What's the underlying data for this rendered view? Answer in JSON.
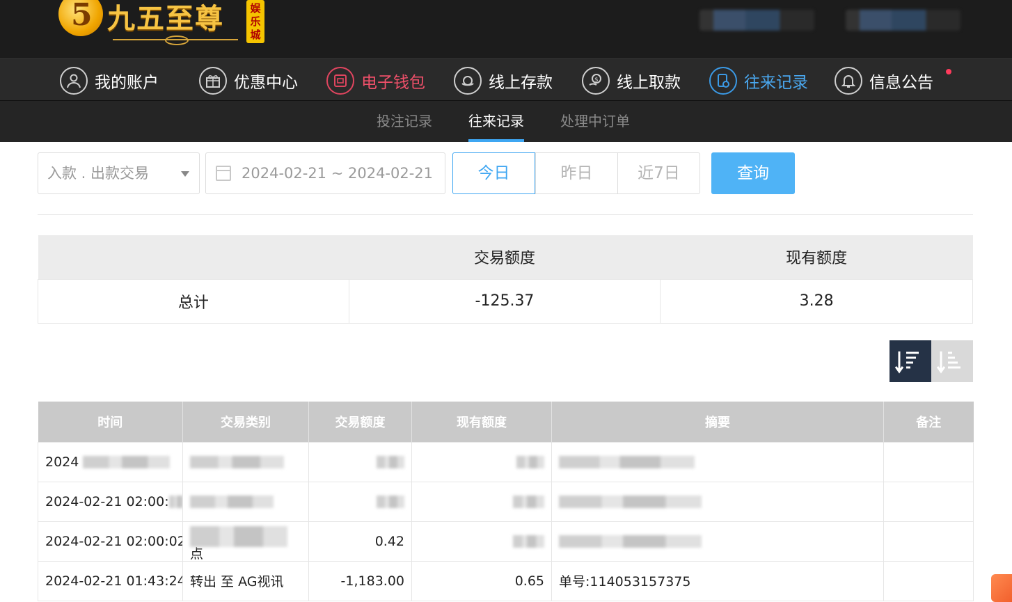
{
  "header": {
    "logo_text": "九五至尊",
    "logo_tag": "娱乐城"
  },
  "mainnav": {
    "items": [
      {
        "label": "我的账户",
        "icon": "user-icon"
      },
      {
        "label": "优惠中心",
        "icon": "gift-icon"
      },
      {
        "label": "电子钱包",
        "icon": "wallet-icon"
      },
      {
        "label": "线上存款",
        "icon": "deposit-icon"
      },
      {
        "label": "线上取款",
        "icon": "withdraw-icon"
      },
      {
        "label": "往来记录",
        "icon": "records-icon"
      },
      {
        "label": "信息公告",
        "icon": "bell-icon"
      }
    ]
  },
  "subnav": {
    "tabs": [
      "投注记录",
      "往来记录",
      "处理中订单"
    ],
    "active": "往来记录"
  },
  "filters": {
    "type_select": "入款 . 出款交易",
    "date_range": "2024-02-21 ~ 2024-02-21",
    "quick": [
      "今日",
      "昨日",
      "近7日"
    ],
    "query_button": "查询"
  },
  "summary": {
    "headers": [
      "",
      "交易额度",
      "现有额度"
    ],
    "row": {
      "label": "总计",
      "amount": "-125.37",
      "balance": "3.28"
    }
  },
  "records": {
    "headers": [
      "时间",
      "交易类别",
      "交易额度",
      "现有额度",
      "摘要",
      "备注"
    ],
    "rows": [
      {
        "time": "2024",
        "type": "",
        "amount": "",
        "balance": "",
        "summary": "",
        "note": ""
      },
      {
        "time": "2024-02-21 02:00:",
        "type": "",
        "amount": "",
        "balance": "",
        "summary": "",
        "note": ""
      },
      {
        "time": "2024-02-21 02:00:02",
        "type": "点",
        "amount": "0.42",
        "balance": "",
        "summary": "",
        "note": ""
      },
      {
        "time": "2024-02-21 01:43:24",
        "type": "转出 至 AG视讯",
        "amount": "-1,183.00",
        "balance": "0.65",
        "summary": "单号:114053157375",
        "note": ""
      }
    ]
  },
  "colors": {
    "accent": "#3ea6f2",
    "wallet": "#f0506a",
    "header_bg": "#1c1c1c"
  }
}
